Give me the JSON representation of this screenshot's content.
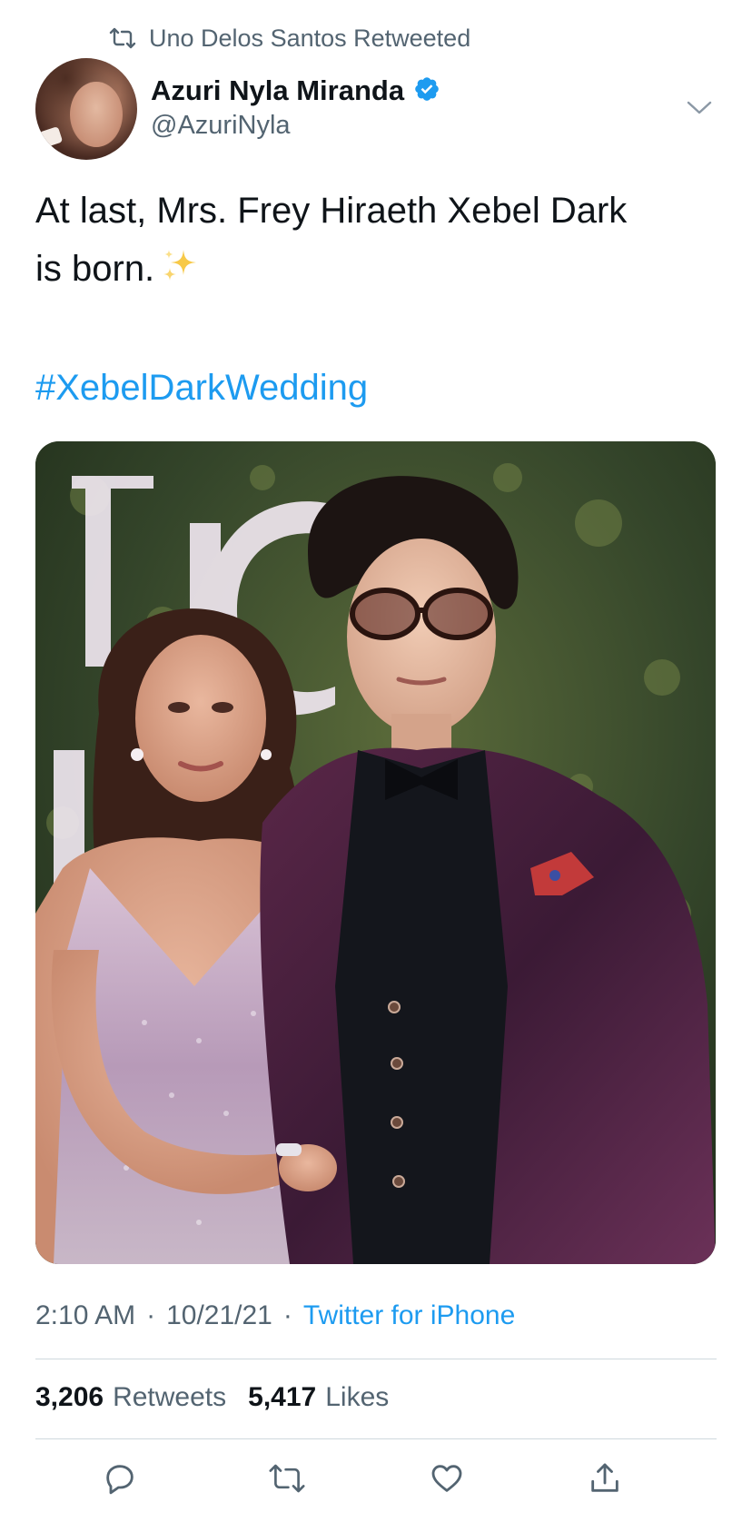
{
  "retweet_context": {
    "text": "Uno Delos Santos Retweeted",
    "icon": "retweet-icon"
  },
  "author": {
    "display_name": "Azuri Nyla Miranda",
    "handle": "@AzuriNyla",
    "verified": true,
    "verified_color": "#1d9bf0"
  },
  "tweet": {
    "text_line1": "At last, Mrs. Frey Hiraeth Xebel Dark",
    "text_line2": "is born.",
    "emoji": "sparkles",
    "hashtag": "#XebelDarkWedding",
    "image_alt": "photo of a couple on a red carpet"
  },
  "meta": {
    "time": "2:10 AM",
    "separator1": "·",
    "date": "10/21/21",
    "separator2": "·",
    "source": "Twitter for iPhone"
  },
  "stats": {
    "retweets_count": "3,206",
    "retweets_label": "Retweets",
    "likes_count": "5,417",
    "likes_label": "Likes"
  },
  "actions": [
    {
      "name": "reply",
      "icon": "reply-icon"
    },
    {
      "name": "retweet",
      "icon": "retweet-icon"
    },
    {
      "name": "like",
      "icon": "heart-icon"
    },
    {
      "name": "share",
      "icon": "share-icon"
    }
  ],
  "colors": {
    "link": "#1d9bf0",
    "secondary_text": "#536471",
    "primary_text": "#0f1419",
    "divider": "#cfd9de"
  }
}
